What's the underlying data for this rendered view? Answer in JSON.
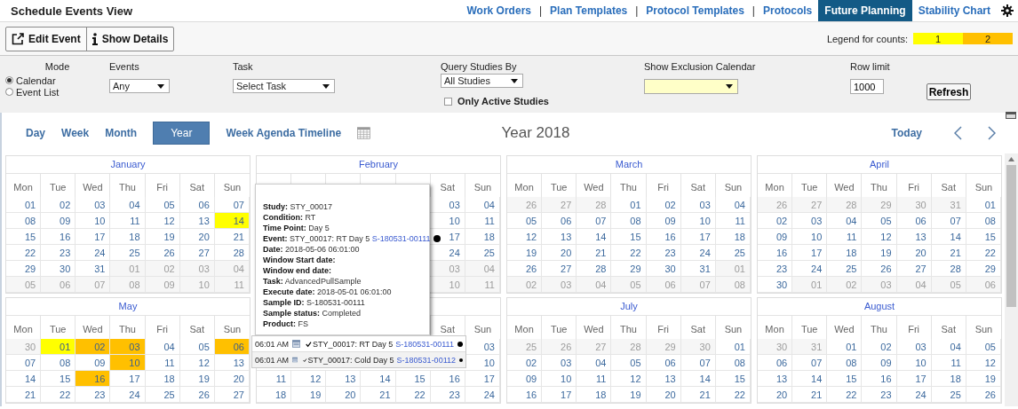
{
  "header": {
    "title": "Schedule Events View",
    "nav": [
      {
        "kind": "link",
        "label": "Work Orders",
        "selected": false
      },
      {
        "kind": "separator",
        "label": "|"
      },
      {
        "kind": "link",
        "label": "Plan Templates",
        "selected": false
      },
      {
        "kind": "separator",
        "label": "|"
      },
      {
        "kind": "link",
        "label": "Protocol Templates",
        "selected": false
      },
      {
        "kind": "separator",
        "label": "|"
      },
      {
        "kind": "link",
        "label": "Protocols",
        "selected": false
      },
      {
        "kind": "link",
        "label": "Future Planning",
        "selected": true
      },
      {
        "kind": "link",
        "label": "Stability Chart",
        "selected": false
      }
    ]
  },
  "toolbar": {
    "buttons": [
      {
        "kind": "edit",
        "label": "Edit Event"
      },
      {
        "kind": "info",
        "label": "Show Details"
      }
    ],
    "legend": {
      "label": "Legend for counts:",
      "items": [
        {
          "label": "1",
          "color": "#ffff00"
        },
        {
          "label": "2",
          "color": "#ffc000"
        }
      ]
    }
  },
  "filters": {
    "mode": {
      "label": "Mode",
      "options": [
        {
          "label": "Calendar",
          "selected": true
        },
        {
          "label": "Event List",
          "selected": false
        }
      ]
    },
    "events": {
      "label": "Events",
      "value": "Any"
    },
    "task": {
      "label": "Task",
      "value": "Select Task"
    },
    "query": {
      "label": "Query Studies By",
      "value": "All Studies",
      "checkbox": {
        "label": "Only Active Studies",
        "checked": false
      }
    },
    "exclusion": {
      "label": "Show Exclusion Calendar"
    },
    "row_limit": {
      "label": "Row limit",
      "value": "1000"
    },
    "refresh": "Refresh"
  },
  "view": {
    "tabs": [
      {
        "label": "Day",
        "selected": false
      },
      {
        "label": "Week",
        "selected": false
      },
      {
        "label": "Month",
        "selected": false
      },
      {
        "label": "Year",
        "selected": true
      },
      {
        "label": "Week Agenda Timeline",
        "selected": false
      }
    ],
    "title": "Year 2018",
    "today": "Today"
  },
  "months": [
    {
      "name": "January",
      "weekdays": [
        "Mon",
        "Tue",
        "Wed",
        "Thu",
        "Fri",
        "Sat",
        "Sun"
      ],
      "weeks": [
        [
          {
            "day": "01",
            "outside": false
          },
          {
            "day": "02",
            "outside": false
          },
          {
            "day": "03",
            "outside": false
          },
          {
            "day": "04",
            "outside": false
          },
          {
            "day": "05",
            "outside": false
          },
          {
            "day": "06",
            "outside": false
          },
          {
            "day": "07",
            "outside": false
          }
        ],
        [
          {
            "day": "08",
            "outside": false
          },
          {
            "day": "09",
            "outside": false
          },
          {
            "day": "10",
            "outside": false
          },
          {
            "day": "11",
            "outside": false
          },
          {
            "day": "12",
            "outside": false
          },
          {
            "day": "13",
            "outside": false
          },
          {
            "day": "14",
            "outside": false,
            "color": "#ffff00"
          }
        ],
        [
          {
            "day": "15",
            "outside": false
          },
          {
            "day": "16",
            "outside": false
          },
          {
            "day": "17",
            "outside": false
          },
          {
            "day": "18",
            "outside": false
          },
          {
            "day": "19",
            "outside": false
          },
          {
            "day": "20",
            "outside": false
          },
          {
            "day": "21",
            "outside": false
          }
        ],
        [
          {
            "day": "22",
            "outside": false
          },
          {
            "day": "23",
            "outside": false
          },
          {
            "day": "24",
            "outside": false
          },
          {
            "day": "25",
            "outside": false
          },
          {
            "day": "26",
            "outside": false
          },
          {
            "day": "27",
            "outside": false
          },
          {
            "day": "28",
            "outside": false
          }
        ],
        [
          {
            "day": "29",
            "outside": false
          },
          {
            "day": "30",
            "outside": false
          },
          {
            "day": "31",
            "outside": false
          },
          {
            "day": "01",
            "outside": true
          },
          {
            "day": "02",
            "outside": true
          },
          {
            "day": "03",
            "outside": true
          },
          {
            "day": "04",
            "outside": true
          }
        ],
        [
          {
            "day": "05",
            "outside": true
          },
          {
            "day": "06",
            "outside": true
          },
          {
            "day": "07",
            "outside": true
          },
          {
            "day": "08",
            "outside": true
          },
          {
            "day": "09",
            "outside": true
          },
          {
            "day": "10",
            "outside": true
          },
          {
            "day": "11",
            "outside": true
          }
        ]
      ]
    },
    {
      "name": "February",
      "weekdays": [
        "Sat",
        "Sun"
      ],
      "weeks": [
        [
          {
            "day": "03",
            "outside": false
          },
          {
            "day": "04",
            "outside": false
          }
        ],
        [
          {
            "day": "10",
            "outside": false
          },
          {
            "day": "11",
            "outside": false
          }
        ],
        [
          {
            "day": "17",
            "outside": false
          },
          {
            "day": "18",
            "outside": false
          }
        ],
        [
          {
            "day": "24",
            "outside": false
          },
          {
            "day": "25",
            "outside": false
          }
        ],
        [
          {
            "day": "03",
            "outside": true
          },
          {
            "day": "04",
            "outside": true
          }
        ],
        [
          {
            "day": "10",
            "outside": true
          },
          {
            "day": "11",
            "outside": true
          }
        ]
      ]
    },
    {
      "name": "March",
      "weekdays": [
        "Mon",
        "Tue",
        "Wed",
        "Thu",
        "Fri",
        "Sat",
        "Sun"
      ],
      "weeks": [
        [
          {
            "day": "26",
            "outside": true
          },
          {
            "day": "27",
            "outside": true
          },
          {
            "day": "28",
            "outside": true
          },
          {
            "day": "01",
            "outside": false
          },
          {
            "day": "02",
            "outside": false
          },
          {
            "day": "03",
            "outside": false
          },
          {
            "day": "04",
            "outside": false
          }
        ],
        [
          {
            "day": "05",
            "outside": false
          },
          {
            "day": "06",
            "outside": false
          },
          {
            "day": "07",
            "outside": false
          },
          {
            "day": "08",
            "outside": false
          },
          {
            "day": "09",
            "outside": false
          },
          {
            "day": "10",
            "outside": false
          },
          {
            "day": "11",
            "outside": false
          }
        ],
        [
          {
            "day": "12",
            "outside": false
          },
          {
            "day": "13",
            "outside": false
          },
          {
            "day": "14",
            "outside": false
          },
          {
            "day": "15",
            "outside": false
          },
          {
            "day": "16",
            "outside": false
          },
          {
            "day": "17",
            "outside": false
          },
          {
            "day": "18",
            "outside": false
          }
        ],
        [
          {
            "day": "19",
            "outside": false
          },
          {
            "day": "20",
            "outside": false
          },
          {
            "day": "21",
            "outside": false
          },
          {
            "day": "22",
            "outside": false
          },
          {
            "day": "23",
            "outside": false
          },
          {
            "day": "24",
            "outside": false
          },
          {
            "day": "25",
            "outside": false
          }
        ],
        [
          {
            "day": "26",
            "outside": false
          },
          {
            "day": "27",
            "outside": false
          },
          {
            "day": "28",
            "outside": false
          },
          {
            "day": "29",
            "outside": false
          },
          {
            "day": "30",
            "outside": false
          },
          {
            "day": "31",
            "outside": false
          },
          {
            "day": "01",
            "outside": true
          }
        ],
        [
          {
            "day": "02",
            "outside": true
          },
          {
            "day": "03",
            "outside": true
          },
          {
            "day": "04",
            "outside": true
          },
          {
            "day": "05",
            "outside": true
          },
          {
            "day": "06",
            "outside": true
          },
          {
            "day": "07",
            "outside": true
          },
          {
            "day": "08",
            "outside": true
          }
        ]
      ]
    },
    {
      "name": "April",
      "weekdays": [
        "Mon",
        "Tue",
        "Wed",
        "Thu",
        "Fri",
        "Sat",
        "Sun"
      ],
      "weeks": [
        [
          {
            "day": "26",
            "outside": true
          },
          {
            "day": "27",
            "outside": true
          },
          {
            "day": "28",
            "outside": true
          },
          {
            "day": "29",
            "outside": true
          },
          {
            "day": "30",
            "outside": true
          },
          {
            "day": "31",
            "outside": true
          },
          {
            "day": "01",
            "outside": false
          }
        ],
        [
          {
            "day": "02",
            "outside": false
          },
          {
            "day": "03",
            "outside": false
          },
          {
            "day": "04",
            "outside": false
          },
          {
            "day": "05",
            "outside": false
          },
          {
            "day": "06",
            "outside": false
          },
          {
            "day": "07",
            "outside": false
          },
          {
            "day": "08",
            "outside": false
          }
        ],
        [
          {
            "day": "09",
            "outside": false
          },
          {
            "day": "10",
            "outside": false
          },
          {
            "day": "11",
            "outside": false
          },
          {
            "day": "12",
            "outside": false
          },
          {
            "day": "13",
            "outside": false
          },
          {
            "day": "14",
            "outside": false
          },
          {
            "day": "15",
            "outside": false
          }
        ],
        [
          {
            "day": "16",
            "outside": false
          },
          {
            "day": "17",
            "outside": false
          },
          {
            "day": "18",
            "outside": false
          },
          {
            "day": "19",
            "outside": false
          },
          {
            "day": "20",
            "outside": false
          },
          {
            "day": "21",
            "outside": false
          },
          {
            "day": "22",
            "outside": false
          }
        ],
        [
          {
            "day": "23",
            "outside": false
          },
          {
            "day": "24",
            "outside": false
          },
          {
            "day": "25",
            "outside": false
          },
          {
            "day": "26",
            "outside": false
          },
          {
            "day": "27",
            "outside": false
          },
          {
            "day": "28",
            "outside": false
          },
          {
            "day": "29",
            "outside": false
          }
        ],
        [
          {
            "day": "30",
            "outside": false
          },
          {
            "day": "01",
            "outside": true
          },
          {
            "day": "02",
            "outside": true
          },
          {
            "day": "03",
            "outside": true
          },
          {
            "day": "04",
            "outside": true
          },
          {
            "day": "05",
            "outside": true
          },
          {
            "day": "06",
            "outside": true
          }
        ]
      ]
    },
    {
      "name": "May",
      "weekdays": [
        "Mon",
        "Tue",
        "Wed",
        "Thu",
        "Fri",
        "Sat",
        "Sun"
      ],
      "weeks": [
        [
          {
            "day": "30",
            "outside": true
          },
          {
            "day": "01",
            "outside": false,
            "color": "#ffff00"
          },
          {
            "day": "02",
            "outside": false,
            "color": "#ffc000"
          },
          {
            "day": "03",
            "outside": false,
            "color": "#ffc000"
          },
          {
            "day": "04",
            "outside": false
          },
          {
            "day": "05",
            "outside": false
          },
          {
            "day": "06",
            "outside": false,
            "color": "#ffc000"
          }
        ],
        [
          {
            "day": "07",
            "outside": false
          },
          {
            "day": "08",
            "outside": false
          },
          {
            "day": "09",
            "outside": false
          },
          {
            "day": "10",
            "outside": false,
            "color": "#ffc000"
          },
          {
            "day": "11",
            "outside": false
          },
          {
            "day": "12",
            "outside": false
          },
          {
            "day": "13",
            "outside": false
          }
        ],
        [
          {
            "day": "14",
            "outside": false
          },
          {
            "day": "15",
            "outside": false
          },
          {
            "day": "16",
            "outside": false,
            "color": "#ffc000"
          },
          {
            "day": "17",
            "outside": false
          },
          {
            "day": "18",
            "outside": false
          },
          {
            "day": "19",
            "outside": false
          },
          {
            "day": "20",
            "outside": false
          }
        ],
        [
          {
            "day": "21",
            "outside": false
          },
          {
            "day": "22",
            "outside": false
          },
          {
            "day": "23",
            "outside": false
          },
          {
            "day": "24",
            "outside": false
          },
          {
            "day": "25",
            "outside": false
          },
          {
            "day": "26",
            "outside": false
          },
          {
            "day": "27",
            "outside": false
          }
        ]
      ]
    },
    {
      "weekdays": [
        "Sat",
        "Sun"
      ],
      "weeks": [
        [
          {
            "day": "03",
            "outside": false
          }
        ],
        [
          {
            "day": "10",
            "outside": false
          }
        ],
        [
          {
            "day": "11",
            "outside": false
          },
          {
            "day": "12",
            "outside": false
          },
          {
            "day": "13",
            "outside": false
          },
          {
            "day": "14",
            "outside": false
          },
          {
            "day": "15",
            "outside": false
          },
          {
            "day": "16",
            "outside": false
          },
          {
            "day": "17",
            "outside": false
          }
        ],
        [
          {
            "day": "18",
            "outside": false
          },
          {
            "day": "19",
            "outside": false
          },
          {
            "day": "20",
            "outside": false
          },
          {
            "day": "21",
            "outside": false
          },
          {
            "day": "22",
            "outside": false
          },
          {
            "day": "23",
            "outside": false
          },
          {
            "day": "24",
            "outside": false
          }
        ]
      ]
    },
    {
      "name": "July",
      "weekdays": [
        "Mon",
        "Tue",
        "Wed",
        "Thu",
        "Fri",
        "Sat",
        "Sun"
      ],
      "weeks": [
        [
          {
            "day": "25",
            "outside": true
          },
          {
            "day": "26",
            "outside": true
          },
          {
            "day": "27",
            "outside": true
          },
          {
            "day": "28",
            "outside": true
          },
          {
            "day": "29",
            "outside": true
          },
          {
            "day": "30",
            "outside": true
          },
          {
            "day": "01",
            "outside": false
          }
        ],
        [
          {
            "day": "02",
            "outside": false
          },
          {
            "day": "03",
            "outside": false
          },
          {
            "day": "04",
            "outside": false
          },
          {
            "day": "05",
            "outside": false
          },
          {
            "day": "06",
            "outside": false
          },
          {
            "day": "07",
            "outside": false
          },
          {
            "day": "08",
            "outside": false
          }
        ],
        [
          {
            "day": "09",
            "outside": false
          },
          {
            "day": "10",
            "outside": false
          },
          {
            "day": "11",
            "outside": false
          },
          {
            "day": "12",
            "outside": false
          },
          {
            "day": "13",
            "outside": false
          },
          {
            "day": "14",
            "outside": false
          },
          {
            "day": "15",
            "outside": false
          }
        ],
        [
          {
            "day": "16",
            "outside": false
          },
          {
            "day": "17",
            "outside": false
          },
          {
            "day": "18",
            "outside": false
          },
          {
            "day": "19",
            "outside": false
          },
          {
            "day": "20",
            "outside": false
          },
          {
            "day": "21",
            "outside": false
          },
          {
            "day": "22",
            "outside": false
          }
        ]
      ]
    },
    {
      "name": "August",
      "weekdays": [
        "Mon",
        "Tue",
        "Wed",
        "Thu",
        "Fri",
        "Sat",
        "Sun"
      ],
      "weeks": [
        [
          {
            "day": "30",
            "outside": true
          },
          {
            "day": "31",
            "outside": true
          },
          {
            "day": "01",
            "outside": false
          },
          {
            "day": "02",
            "outside": false
          },
          {
            "day": "03",
            "outside": false
          },
          {
            "day": "04",
            "outside": false
          },
          {
            "day": "05",
            "outside": false
          }
        ],
        [
          {
            "day": "06",
            "outside": false
          },
          {
            "day": "07",
            "outside": false
          },
          {
            "day": "08",
            "outside": false
          },
          {
            "day": "09",
            "outside": false
          },
          {
            "day": "10",
            "outside": false
          },
          {
            "day": "11",
            "outside": false
          },
          {
            "day": "12",
            "outside": false
          }
        ],
        [
          {
            "day": "13",
            "outside": false
          },
          {
            "day": "14",
            "outside": false
          },
          {
            "day": "15",
            "outside": false
          },
          {
            "day": "16",
            "outside": false
          },
          {
            "day": "17",
            "outside": false
          },
          {
            "day": "18",
            "outside": false
          },
          {
            "day": "19",
            "outside": false
          }
        ],
        [
          {
            "day": "20",
            "outside": false
          },
          {
            "day": "21",
            "outside": false
          },
          {
            "day": "22",
            "outside": false
          },
          {
            "day": "23",
            "outside": false
          },
          {
            "day": "24",
            "outside": false
          },
          {
            "day": "25",
            "outside": false
          },
          {
            "day": "26",
            "outside": false
          }
        ]
      ]
    }
  ],
  "tooltip": {
    "lines": [
      {
        "label": "Study:",
        "value": "STY_00017"
      },
      {
        "label": "Condition:",
        "value": "RT"
      },
      {
        "label": "Time Point:",
        "value": "Day 5"
      },
      {
        "label": "Event:",
        "value": "STY_00017: RT Day 5",
        "link": "S-180531-00111"
      },
      {
        "label": "Date:",
        "value": "2018-05-06 06:01:00"
      },
      {
        "label": "Window Start date:"
      },
      {
        "label": "Window end date:"
      },
      {
        "label": "Task:",
        "value": "AdvancedPullSample"
      },
      {
        "label": "Execute date:",
        "value": "2018-05-01 06:01:00"
      },
      {
        "label": "Sample ID:",
        "value": "S-180531-00111"
      },
      {
        "label": "Sample status:",
        "value": "Completed"
      },
      {
        "label": "Product:",
        "value": "FS"
      }
    ]
  },
  "popup": {
    "events": [
      {
        "time": "06:01 AM",
        "title": "STY_00017: RT Day 5",
        "link": "S-180531-00111"
      },
      {
        "time": "06:01 AM",
        "title": "STY_00017: Cold Day 5",
        "link": "S-180531-00112"
      }
    ]
  }
}
